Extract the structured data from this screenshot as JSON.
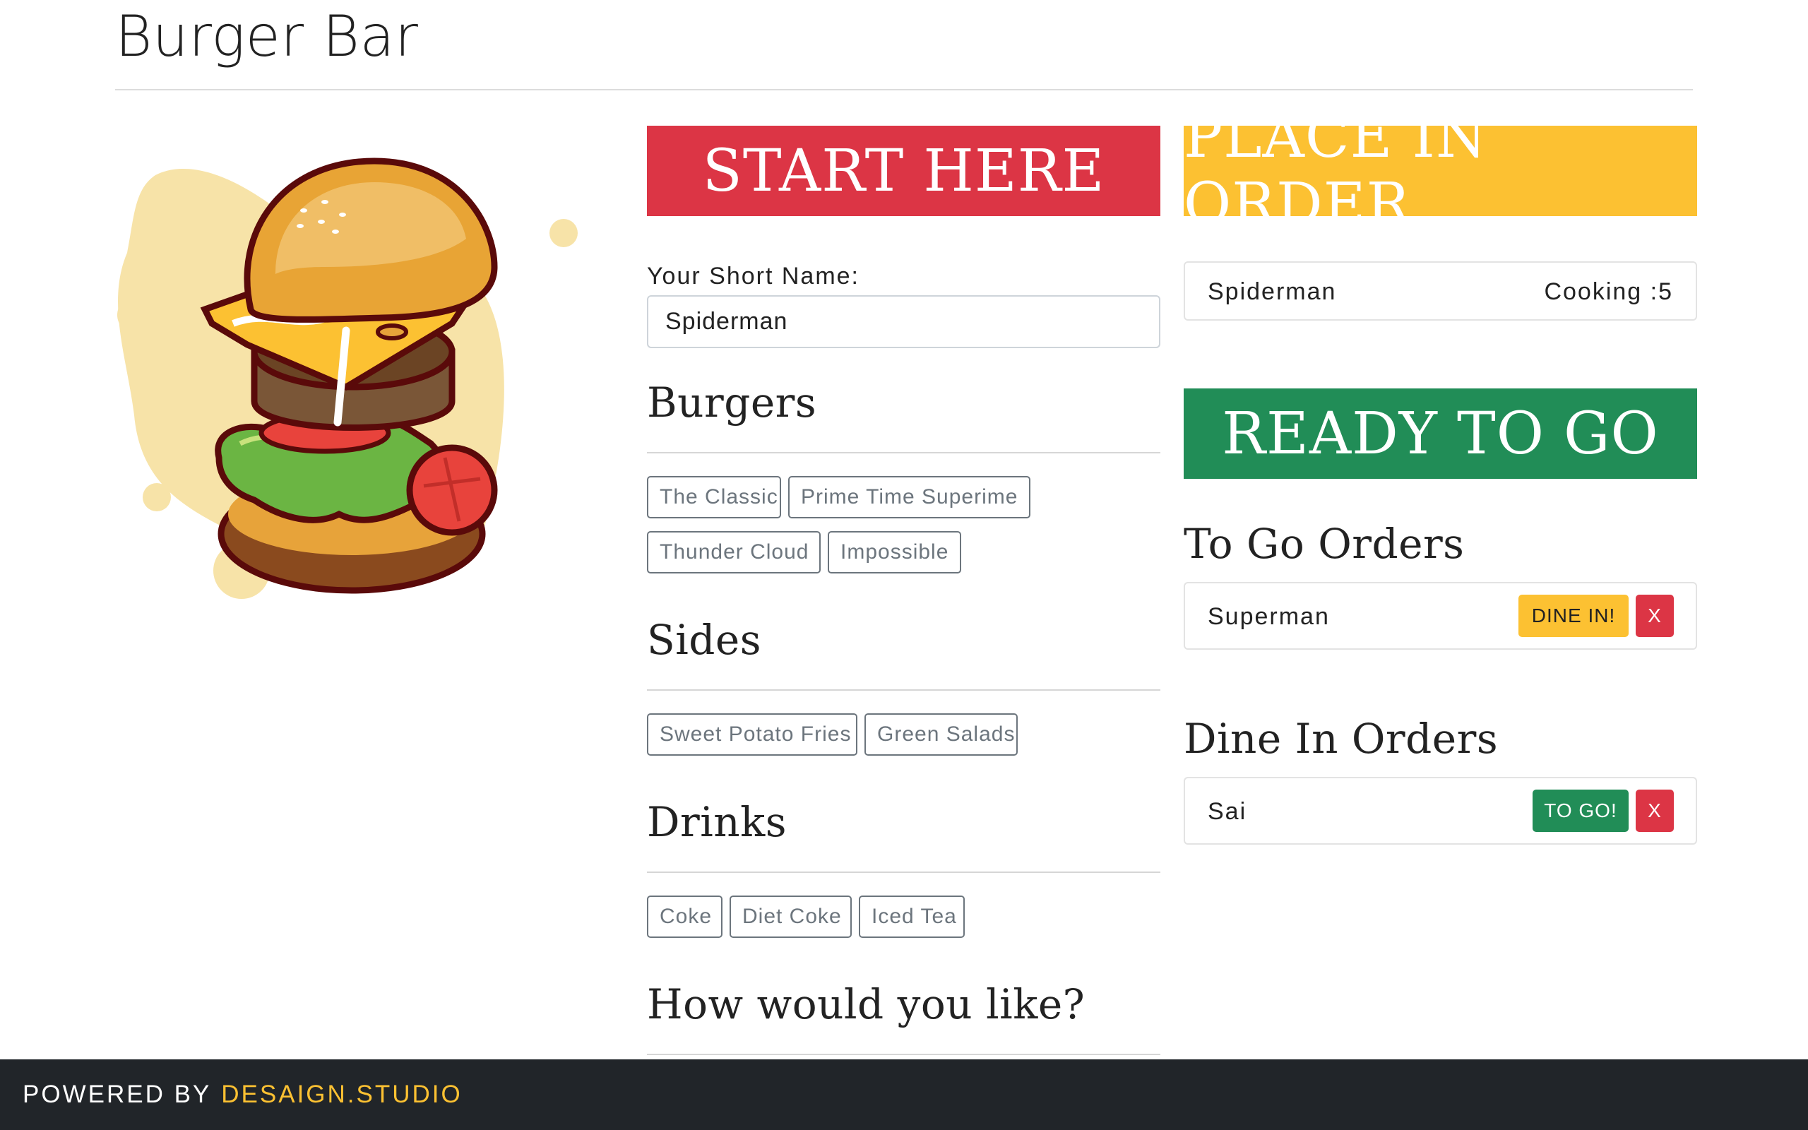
{
  "app": {
    "title": "Burger Bar"
  },
  "banners": {
    "start": "START HERE",
    "place": "PLACE IN ORDER",
    "ready": "READY TO GO"
  },
  "form": {
    "name_label": "Your Short Name:",
    "name_value": "Spiderman"
  },
  "menu": {
    "burgers": {
      "heading": "Burgers",
      "items": [
        "The Classic",
        "Prime Time Superime",
        "Thunder Cloud",
        "Impossible"
      ]
    },
    "sides": {
      "heading": "Sides",
      "items": [
        "Sweet Potato Fries",
        "Green Salads"
      ]
    },
    "drinks": {
      "heading": "Drinks",
      "items": [
        "Coke",
        "Diet Coke",
        "Iced Tea"
      ]
    },
    "style": {
      "heading": "How would you like?"
    }
  },
  "in_progress": {
    "name": "Spiderman",
    "status": "Cooking :5"
  },
  "to_go": {
    "heading": "To Go Orders",
    "orders": [
      {
        "name": "Superman",
        "switch_label": "DINE IN!",
        "remove_label": "X"
      }
    ]
  },
  "dine_in": {
    "heading": "Dine In Orders",
    "orders": [
      {
        "name": "Sai",
        "switch_label": "TO GO!",
        "remove_label": "X"
      }
    ]
  },
  "footer": {
    "prefix": "POWERED BY",
    "brand": "DESAIGN.STUDIO"
  },
  "colors": {
    "red": "#dc3545",
    "yellow": "#fcc132",
    "green": "#218d57",
    "footer_bg": "#212529"
  },
  "icons": {
    "hero": "burger-illustration"
  }
}
